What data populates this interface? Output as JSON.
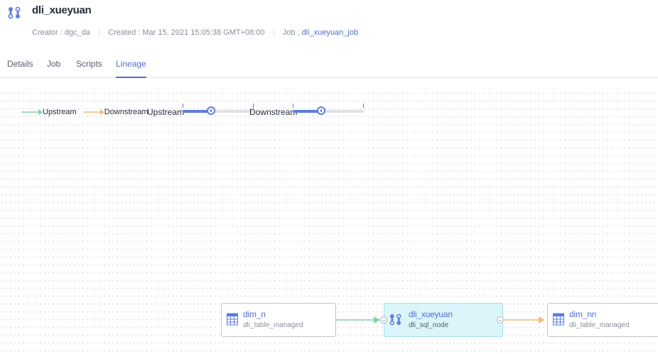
{
  "header": {
    "title": "dli_xueyuan",
    "creator_label": "Creator : ",
    "creator": "dgc_da",
    "created_label": "Created : ",
    "created": "Mar 15, 2021 15:05:38 GMT+08:00",
    "job_label": "Job : ",
    "job": "dli_xueyuan_job",
    "icon": "job-node-icon"
  },
  "tabs": [
    {
      "label": "Details",
      "active": false
    },
    {
      "label": "Job",
      "active": false
    },
    {
      "label": "Scripts",
      "active": false
    },
    {
      "label": "Lineage",
      "active": true
    }
  ],
  "legend": {
    "upstream": {
      "label": "Upstream",
      "color": "#7ed6a0"
    },
    "downstream": {
      "label": "Downstream",
      "color": "#f7b77f"
    }
  },
  "controls": {
    "upstream": {
      "label": "Upstream",
      "level": 0.4
    },
    "downstream": {
      "label": "Downstream",
      "level": 0.4
    }
  },
  "nodes": [
    {
      "name": "dim_n",
      "type": "dli_table_managed",
      "icon": "table-icon"
    },
    {
      "name": "dli_xueyuan",
      "type": "dli_sql_node",
      "icon": "job-node-icon"
    },
    {
      "name": "dim_nn",
      "type": "dli_table_managed",
      "icon": "table-icon"
    }
  ],
  "colors": {
    "accent": "#526ecc",
    "slider": "#5e7ce0",
    "selected_node_bg": "#dbf5fb",
    "upstream_edge": "#7ed6a0",
    "downstream_edge": "#f7b77f"
  }
}
